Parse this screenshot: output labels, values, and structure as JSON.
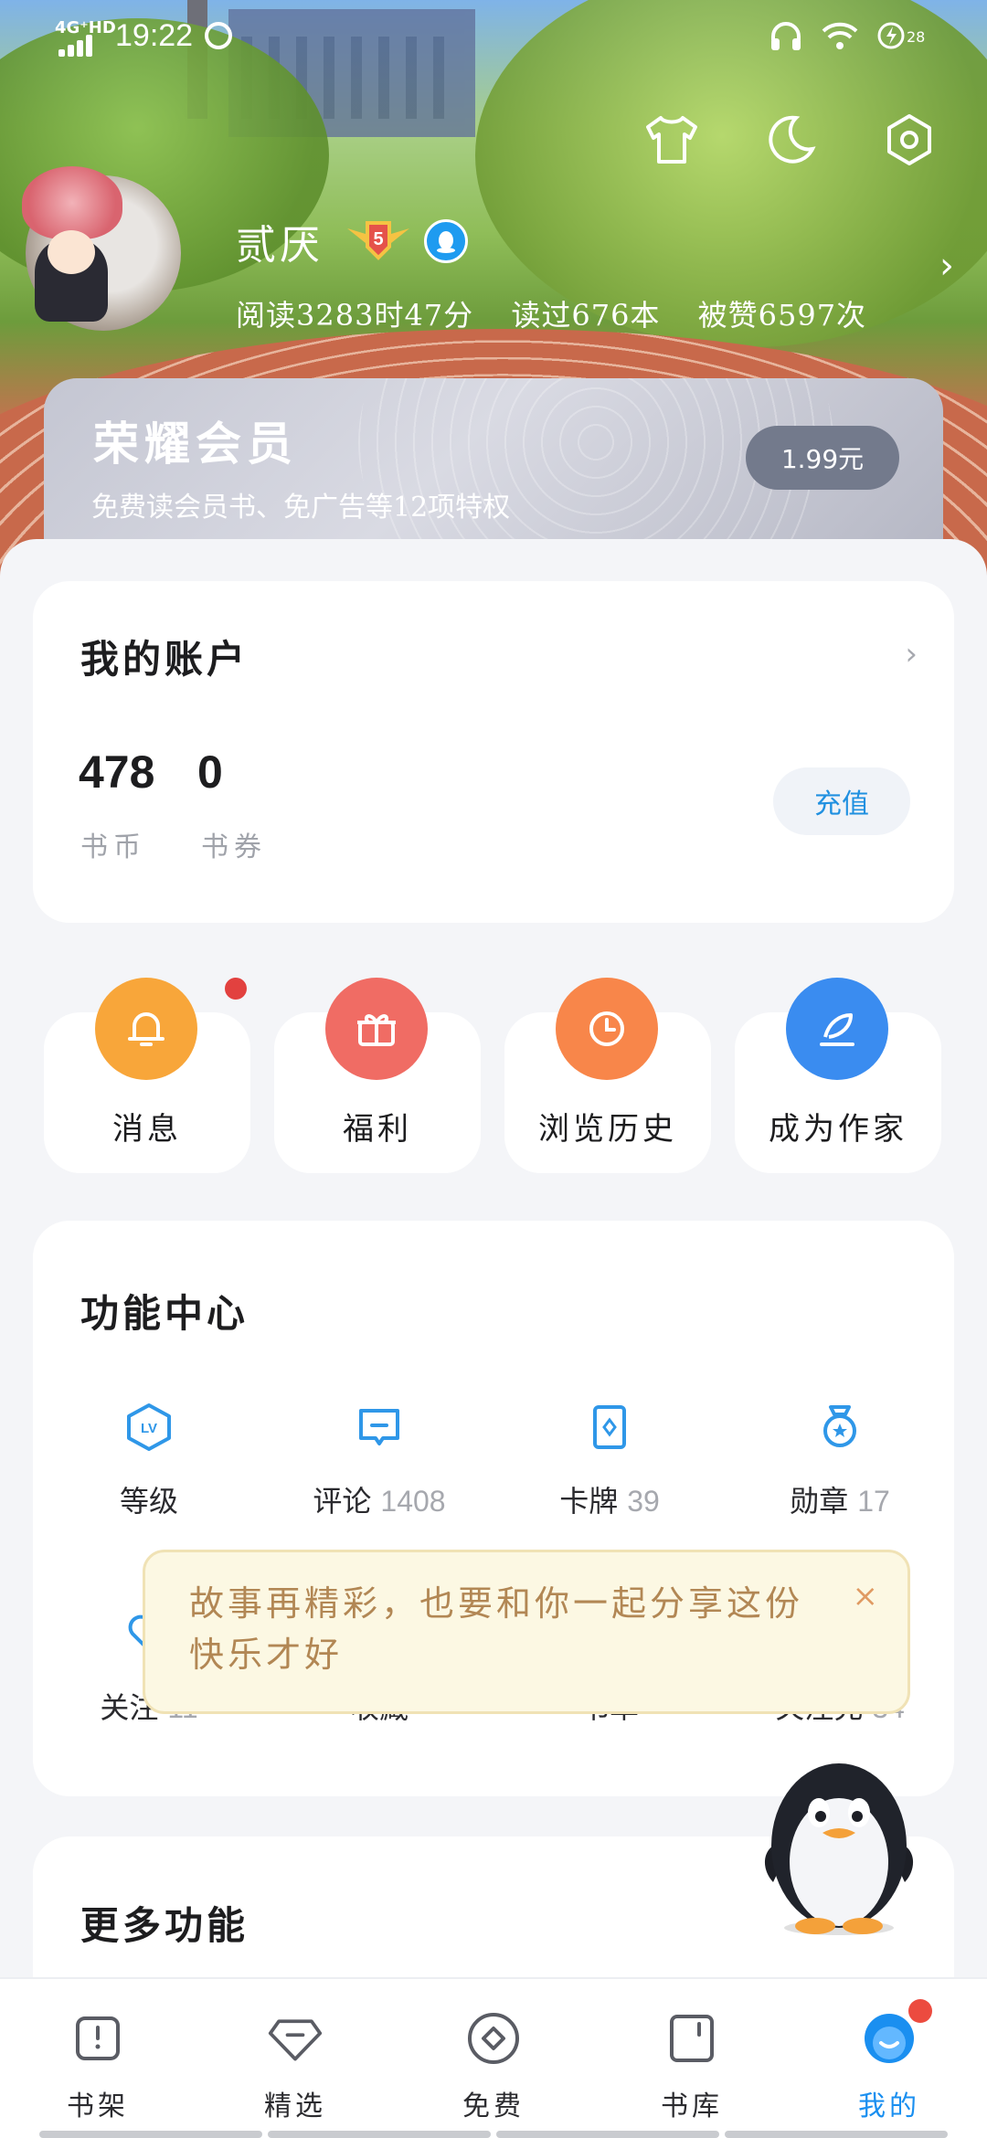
{
  "status_bar": {
    "network": "4G⁺HD",
    "time": "19:22",
    "battery": "28"
  },
  "header": {
    "icons": [
      "shirt-icon",
      "moon-icon",
      "settings-icon"
    ]
  },
  "profile": {
    "username": "贰厌",
    "level": "5",
    "stats": {
      "reading_time": "阅读3283时47分",
      "books_read": "读过676本",
      "likes": "被赞6597次"
    }
  },
  "vip": {
    "title": "荣耀会员",
    "subtitle": "免费读会员书、免广告等12项特权",
    "price": "1.99元"
  },
  "account": {
    "title": "我的账户",
    "coins_value": "478",
    "coins_label": "书币",
    "vouchers_value": "0",
    "vouchers_label": "书券",
    "recharge_label": "充值"
  },
  "quick_actions": [
    {
      "label": "消息",
      "color": "#f8a63a",
      "has_dot": true
    },
    {
      "label": "福利",
      "color": "#f06c64"
    },
    {
      "label": "浏览历史",
      "color": "#f8864a"
    },
    {
      "label": "成为作家",
      "color": "#3a8cf0"
    }
  ],
  "feature_center": {
    "title": "功能中心",
    "items": [
      {
        "label": "等级",
        "count": ""
      },
      {
        "label": "评论",
        "count": "1408"
      },
      {
        "label": "卡牌",
        "count": "39"
      },
      {
        "label": "勋章",
        "count": "17"
      },
      {
        "label": "关注",
        "count": "11"
      },
      {
        "label": "收藏",
        "count": ""
      },
      {
        "label": "书单",
        "count": ""
      },
      {
        "label": "关注充",
        "count": "34"
      }
    ]
  },
  "tooltip": {
    "text": "故事再精彩，也要和你一起分享这份快乐才好",
    "close": "×"
  },
  "more_features": {
    "title": "更多功能"
  },
  "tabbar": {
    "tabs": [
      {
        "label": "书架"
      },
      {
        "label": "精选"
      },
      {
        "label": "免费"
      },
      {
        "label": "书库"
      },
      {
        "label": "我的",
        "active": true
      }
    ]
  },
  "colors": {
    "accent": "#1a8ff0",
    "red_dot": "#e2413f"
  }
}
